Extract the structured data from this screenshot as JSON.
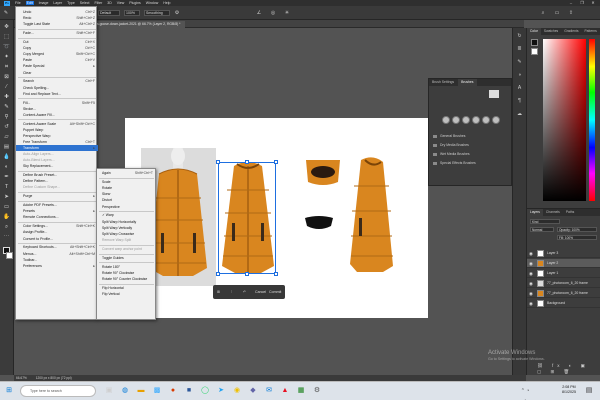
{
  "app": {
    "logo": "Ps",
    "logo_icon": "photoshop-logo-icon"
  },
  "menubar": {
    "items": [
      "File",
      "Edit",
      "Image",
      "Layer",
      "Type",
      "Select",
      "Filter",
      "3D",
      "View",
      "Plugins",
      "Window",
      "Help"
    ],
    "active": "Edit"
  },
  "window_controls": [
    "–",
    "❐",
    "✕"
  ],
  "options_bar": {
    "mode": "Default",
    "opacity": "100%",
    "flow": "Smoothing"
  },
  "document": {
    "tab_title": "new-canada-goose-down-jacket-2021 @ 66.7% (Layer 2, RGB/8) *"
  },
  "edit_menu": [
    {
      "label": "Undo",
      "shortcut": "Ctrl+Z"
    },
    {
      "label": "Redo",
      "shortcut": "Shift+Ctrl+Z"
    },
    {
      "label": "Toggle Last State",
      "shortcut": "Alt+Ctrl+Z"
    },
    {
      "sep": true
    },
    {
      "label": "Fade...",
      "shortcut": "Shift+Ctrl+F"
    },
    {
      "sep": true
    },
    {
      "label": "Cut",
      "shortcut": "Ctrl+X"
    },
    {
      "label": "Copy",
      "shortcut": "Ctrl+C"
    },
    {
      "label": "Copy Merged",
      "shortcut": "Shift+Ctrl+C"
    },
    {
      "label": "Paste",
      "shortcut": "Ctrl+V"
    },
    {
      "label": "Paste Special",
      "shortcut": "▸"
    },
    {
      "label": "Clear",
      "shortcut": ""
    },
    {
      "sep": true
    },
    {
      "label": "Search",
      "shortcut": "Ctrl+F"
    },
    {
      "label": "Check Spelling...",
      "shortcut": ""
    },
    {
      "label": "Find and Replace Text...",
      "shortcut": ""
    },
    {
      "sep": true
    },
    {
      "label": "Fill...",
      "shortcut": "Shift+F5"
    },
    {
      "label": "Stroke...",
      "shortcut": ""
    },
    {
      "label": "Content-Aware Fill...",
      "shortcut": ""
    },
    {
      "sep": true
    },
    {
      "label": "Content-Aware Scale",
      "shortcut": "Alt+Shift+Ctrl+C"
    },
    {
      "label": "Puppet Warp",
      "shortcut": ""
    },
    {
      "label": "Perspective Warp",
      "shortcut": ""
    },
    {
      "label": "Free Transform",
      "shortcut": "Ctrl+T"
    },
    {
      "label": "Transform",
      "shortcut": "▸",
      "highlight": true
    },
    {
      "label": "Auto-Align Layers...",
      "shortcut": "",
      "disabled": true
    },
    {
      "label": "Auto-Blend Layers...",
      "shortcut": "",
      "disabled": true
    },
    {
      "label": "Sky Replacement...",
      "shortcut": ""
    },
    {
      "sep": true
    },
    {
      "label": "Define Brush Preset...",
      "shortcut": ""
    },
    {
      "label": "Define Pattern...",
      "shortcut": ""
    },
    {
      "label": "Define Custom Shape...",
      "shortcut": "",
      "disabled": true
    },
    {
      "sep": true
    },
    {
      "label": "Purge",
      "shortcut": "▸"
    },
    {
      "sep": true
    },
    {
      "label": "Adobe PDF Presets...",
      "shortcut": ""
    },
    {
      "label": "Presets",
      "shortcut": "▸"
    },
    {
      "label": "Remote Connections...",
      "shortcut": ""
    },
    {
      "sep": true
    },
    {
      "label": "Color Settings...",
      "shortcut": "Shift+Ctrl+K"
    },
    {
      "label": "Assign Profile...",
      "shortcut": ""
    },
    {
      "label": "Convert to Profile...",
      "shortcut": ""
    },
    {
      "sep": true
    },
    {
      "label": "Keyboard Shortcuts...",
      "shortcut": "Alt+Shift+Ctrl+K"
    },
    {
      "label": "Menus...",
      "shortcut": "Alt+Shift+Ctrl+M"
    },
    {
      "label": "Toolbar...",
      "shortcut": ""
    },
    {
      "label": "Preferences",
      "shortcut": "▸"
    }
  ],
  "transform_submenu": [
    {
      "label": "Again",
      "shortcut": "Shift+Ctrl+T"
    },
    {
      "sep": true
    },
    {
      "label": "Scale",
      "shortcut": ""
    },
    {
      "label": "Rotate",
      "shortcut": ""
    },
    {
      "label": "Skew",
      "shortcut": ""
    },
    {
      "label": "Distort",
      "shortcut": ""
    },
    {
      "label": "Perspective",
      "shortcut": ""
    },
    {
      "sep": true
    },
    {
      "label": "✓ Warp",
      "shortcut": ""
    },
    {
      "label": "Split Warp Horizontally",
      "shortcut": ""
    },
    {
      "label": "Split Warp Vertically",
      "shortcut": ""
    },
    {
      "label": "Split Warp Crosswise",
      "shortcut": ""
    },
    {
      "label": "Remove Warp Split",
      "shortcut": "",
      "disabled": true
    },
    {
      "sep": true
    },
    {
      "label": "Convert warp anchor point",
      "shortcut": "",
      "disabled": true
    },
    {
      "sep": true
    },
    {
      "label": "Toggle Guides",
      "shortcut": ""
    },
    {
      "sep": true
    },
    {
      "label": "Rotate 180°",
      "shortcut": ""
    },
    {
      "label": "Rotate 90° Clockwise",
      "shortcut": ""
    },
    {
      "label": "Rotate 90° Counter Clockwise",
      "shortcut": ""
    },
    {
      "sep": true
    },
    {
      "label": "Flip Horizontal",
      "shortcut": ""
    },
    {
      "label": "Flip Vertical",
      "shortcut": ""
    }
  ],
  "brushes_panel": {
    "tabs": [
      "Brush Settings",
      "Brushes"
    ],
    "active_tab": "Brushes",
    "folders": [
      "General Brushes",
      "Dry Media Brushes",
      "Wet Media Brushes",
      "Special Effects Brushes"
    ]
  },
  "color_panel": {
    "tabs": [
      "Color",
      "Swatches",
      "Gradients",
      "Patterns"
    ],
    "active_tab": "Color",
    "foreground": "#111111",
    "background": "#ffffff"
  },
  "layers_panel": {
    "tabs": [
      "Layers",
      "Channels",
      "Paths"
    ],
    "active_tab": "Layers",
    "blend_mode": "Normal",
    "opacity": "Opacity: 100%",
    "fill": "Fill: 100%",
    "layers": [
      {
        "name": "Layer 3",
        "selected": false
      },
      {
        "name": "Layer 2",
        "selected": true
      },
      {
        "name": "Layer 1",
        "selected": false
      },
      {
        "name": "77_photoroom_6_20 frame",
        "selected": false
      },
      {
        "name": "77_photoroom_6_20 frame",
        "selected": false
      },
      {
        "name": "Background",
        "selected": false
      }
    ]
  },
  "transform_bar": {
    "cancel": "Cancel",
    "commit": "Commit"
  },
  "status_bar": {
    "zoom": "66.67%",
    "doc": "1200 px x 800 px (72 ppi)"
  },
  "activation": {
    "title": "Activate Windows",
    "subtitle": "Go to Settings to activate Windows."
  },
  "taskbar": {
    "search_placeholder": "Type here to search",
    "time": "2:08 PM",
    "date": "8/1/2025"
  },
  "colors": {
    "jacket": "#d9861f",
    "accent": "#31a8ff"
  }
}
